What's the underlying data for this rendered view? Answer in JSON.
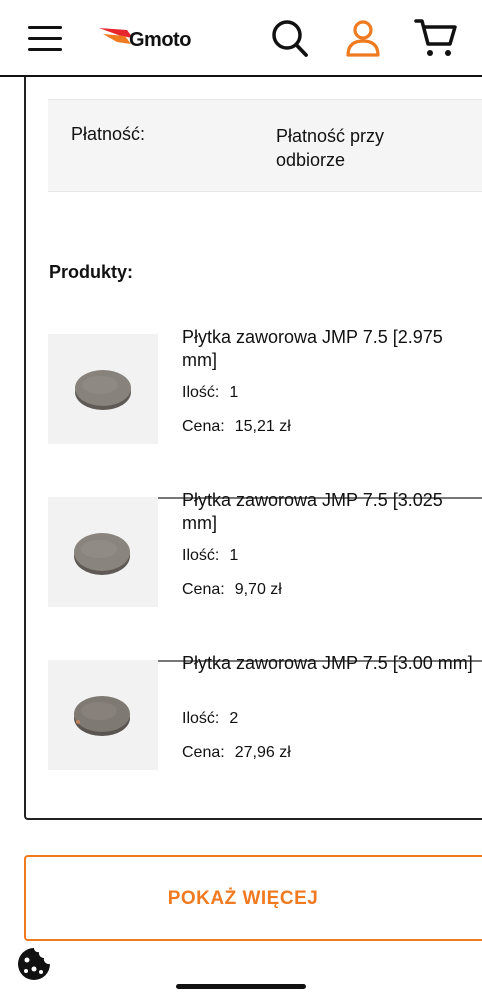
{
  "header": {
    "logo_text": "Gmoto",
    "icons": [
      "hamburger-menu-icon",
      "search-icon",
      "user-icon",
      "cart-icon"
    ],
    "accent_color": "#f07a20"
  },
  "payment": {
    "label": "Płatność:",
    "value": "Płatność przy odbiorze"
  },
  "products_title": "Produkty:",
  "products": [
    {
      "name": "Płytka zaworowa JMP 7.5 [2.975 mm]",
      "qty_label": "Ilość:",
      "qty": "1",
      "price_label": "Cena:",
      "price": "15,21 zł"
    },
    {
      "name": "Płytka zaworowa JMP 7.5 [3.025 mm]",
      "qty_label": "Ilość:",
      "qty": "1",
      "price_label": "Cena:",
      "price": "9,70 zł"
    },
    {
      "name": "Płytka zaworowa JMP 7.5 [3.00 mm]",
      "qty_label": "Ilość:",
      "qty": "2",
      "price_label": "Cena:",
      "price": "27,96 zł"
    }
  ],
  "show_more_label": "POKAŻ WIĘCEJ"
}
